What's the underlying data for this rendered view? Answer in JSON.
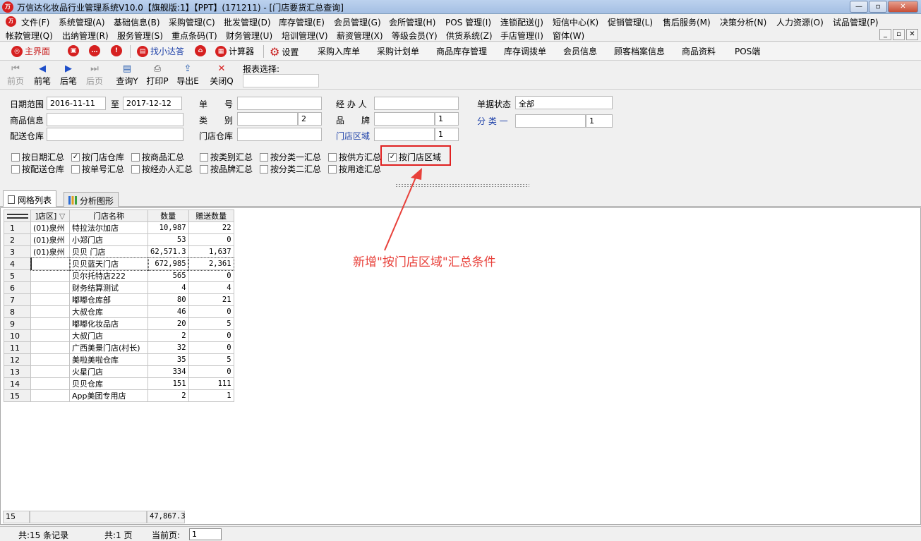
{
  "window": {
    "title": "万信达化妆品行业管理系统V10.0【旗舰版:1】【PPT】(171211) - [门店要货汇总查询]",
    "logo_text": "万"
  },
  "menu_row1": [
    "文件(F)",
    "系统管理(A)",
    "基础信息(B)",
    "采购管理(C)",
    "批发管理(D)",
    "库存管理(E)",
    "会员管理(G)",
    "会所管理(H)",
    "POS 管理(I)",
    "连锁配送(J)",
    "短信中心(K)",
    "促销管理(L)",
    "售后服务(M)",
    "决策分析(N)",
    "人力资源(O)",
    "试品管理(P)"
  ],
  "menu_row2": [
    "帐款管理(Q)",
    "出纳管理(R)",
    "服务管理(S)",
    "重点条码(T)",
    "财务管理(U)",
    "培训管理(V)",
    "薪资管理(X)",
    "等级会员(Y)",
    "供货系统(Z)",
    "手店管理(I)",
    "窗体(W)"
  ],
  "toolbar": {
    "home": "主界面",
    "find": "找小达答",
    "calculator": "计算器",
    "settings": "设置",
    "links": [
      "采购入库单",
      "采购计划单",
      "商品库存管理",
      "库存调拨单",
      "会员信息",
      "顾客档案信息",
      "商品资料",
      "POS端"
    ]
  },
  "navbar": {
    "first": "前页",
    "prev": "前笔",
    "next": "后笔",
    "last": "后页",
    "query": "查询Y",
    "print": "打印P",
    "export": "导出E",
    "close": "关闭Q",
    "report_label": "报表选择:"
  },
  "filters": {
    "date_range_label": "日期范围",
    "date_from": "2016-11-11",
    "date_to_label": "至",
    "date_to": "2017-12-12",
    "doc_no_label": "单　　号",
    "operator_label": "经 办 人",
    "doc_status_label": "单据状态",
    "doc_status_value": "全部",
    "product_info_label": "商品信息",
    "category_label": "类　　别",
    "category_value": "2",
    "brand_label": "品　　牌",
    "brand_value": "1",
    "class1_label": "分 类 一",
    "class1_value": "1",
    "dist_store_label": "配送仓库",
    "store_wh_label": "门店仓库",
    "store_region_label": "门店区域",
    "store_region_value": "1"
  },
  "checkboxes": [
    {
      "label": "按日期汇总",
      "checked": false
    },
    {
      "label": "按门店仓库",
      "checked": true
    },
    {
      "label": "按商品汇总",
      "checked": false
    },
    {
      "label": "按类别汇总",
      "checked": false
    },
    {
      "label": "按分类一汇总",
      "checked": false
    },
    {
      "label": "按供方汇总",
      "checked": false
    },
    {
      "label": "按门店区域",
      "checked": true
    },
    {
      "label": "按配送仓库",
      "checked": false
    },
    {
      "label": "按单号汇总",
      "checked": false
    },
    {
      "label": "按经办人汇总",
      "checked": false
    },
    {
      "label": "按品牌汇总",
      "checked": false
    },
    {
      "label": "按分类二汇总",
      "checked": false
    },
    {
      "label": "按用途汇总",
      "checked": false
    }
  ],
  "tabs": [
    "网格列表",
    "分析图形"
  ],
  "grid": {
    "headers": [
      "",
      "]店区]",
      "门店名称",
      "数量",
      "赠送数量"
    ],
    "sort_indicator": "▽",
    "rows": [
      [
        "1",
        "(01)泉州",
        "特拉法尔加店",
        "10,987",
        "22"
      ],
      [
        "2",
        "(01)泉州",
        "小郑门店",
        "53",
        "0"
      ],
      [
        "3",
        "(01)泉州",
        "贝贝 门店",
        "62,571.3",
        "1,637"
      ],
      [
        "4",
        "",
        "贝贝蓝天门店",
        "672,985",
        "2,361"
      ],
      [
        "5",
        "",
        "贝尔托特店222",
        "565",
        "0"
      ],
      [
        "6",
        "",
        "财务结算测试",
        "4",
        "4"
      ],
      [
        "7",
        "",
        "嘟嘟仓库部",
        "80",
        "21"
      ],
      [
        "8",
        "",
        "大叔仓库",
        "46",
        "0"
      ],
      [
        "9",
        "",
        "嘟嘟化妆品店",
        "20",
        "5"
      ],
      [
        "10",
        "",
        "大叔门店",
        "2",
        "0"
      ],
      [
        "11",
        "",
        "广西美景门店(村长)",
        "32",
        "0"
      ],
      [
        "12",
        "",
        "美啦美啦仓库",
        "35",
        "5"
      ],
      [
        "13",
        "",
        "火星门店",
        "334",
        "0"
      ],
      [
        "14",
        "",
        "贝贝仓库",
        "151",
        "111"
      ],
      [
        "15",
        "",
        "App美团专用店",
        "2",
        "1"
      ]
    ],
    "footer": {
      "count": "15",
      "qty_total": "47,867.3"
    }
  },
  "annotation": "新增\"按门店区域\"汇总条件",
  "status": {
    "records": "共:15 条记录",
    "pages": "共:1 页",
    "current_page_label": "当前页:",
    "current_page_value": "1"
  }
}
